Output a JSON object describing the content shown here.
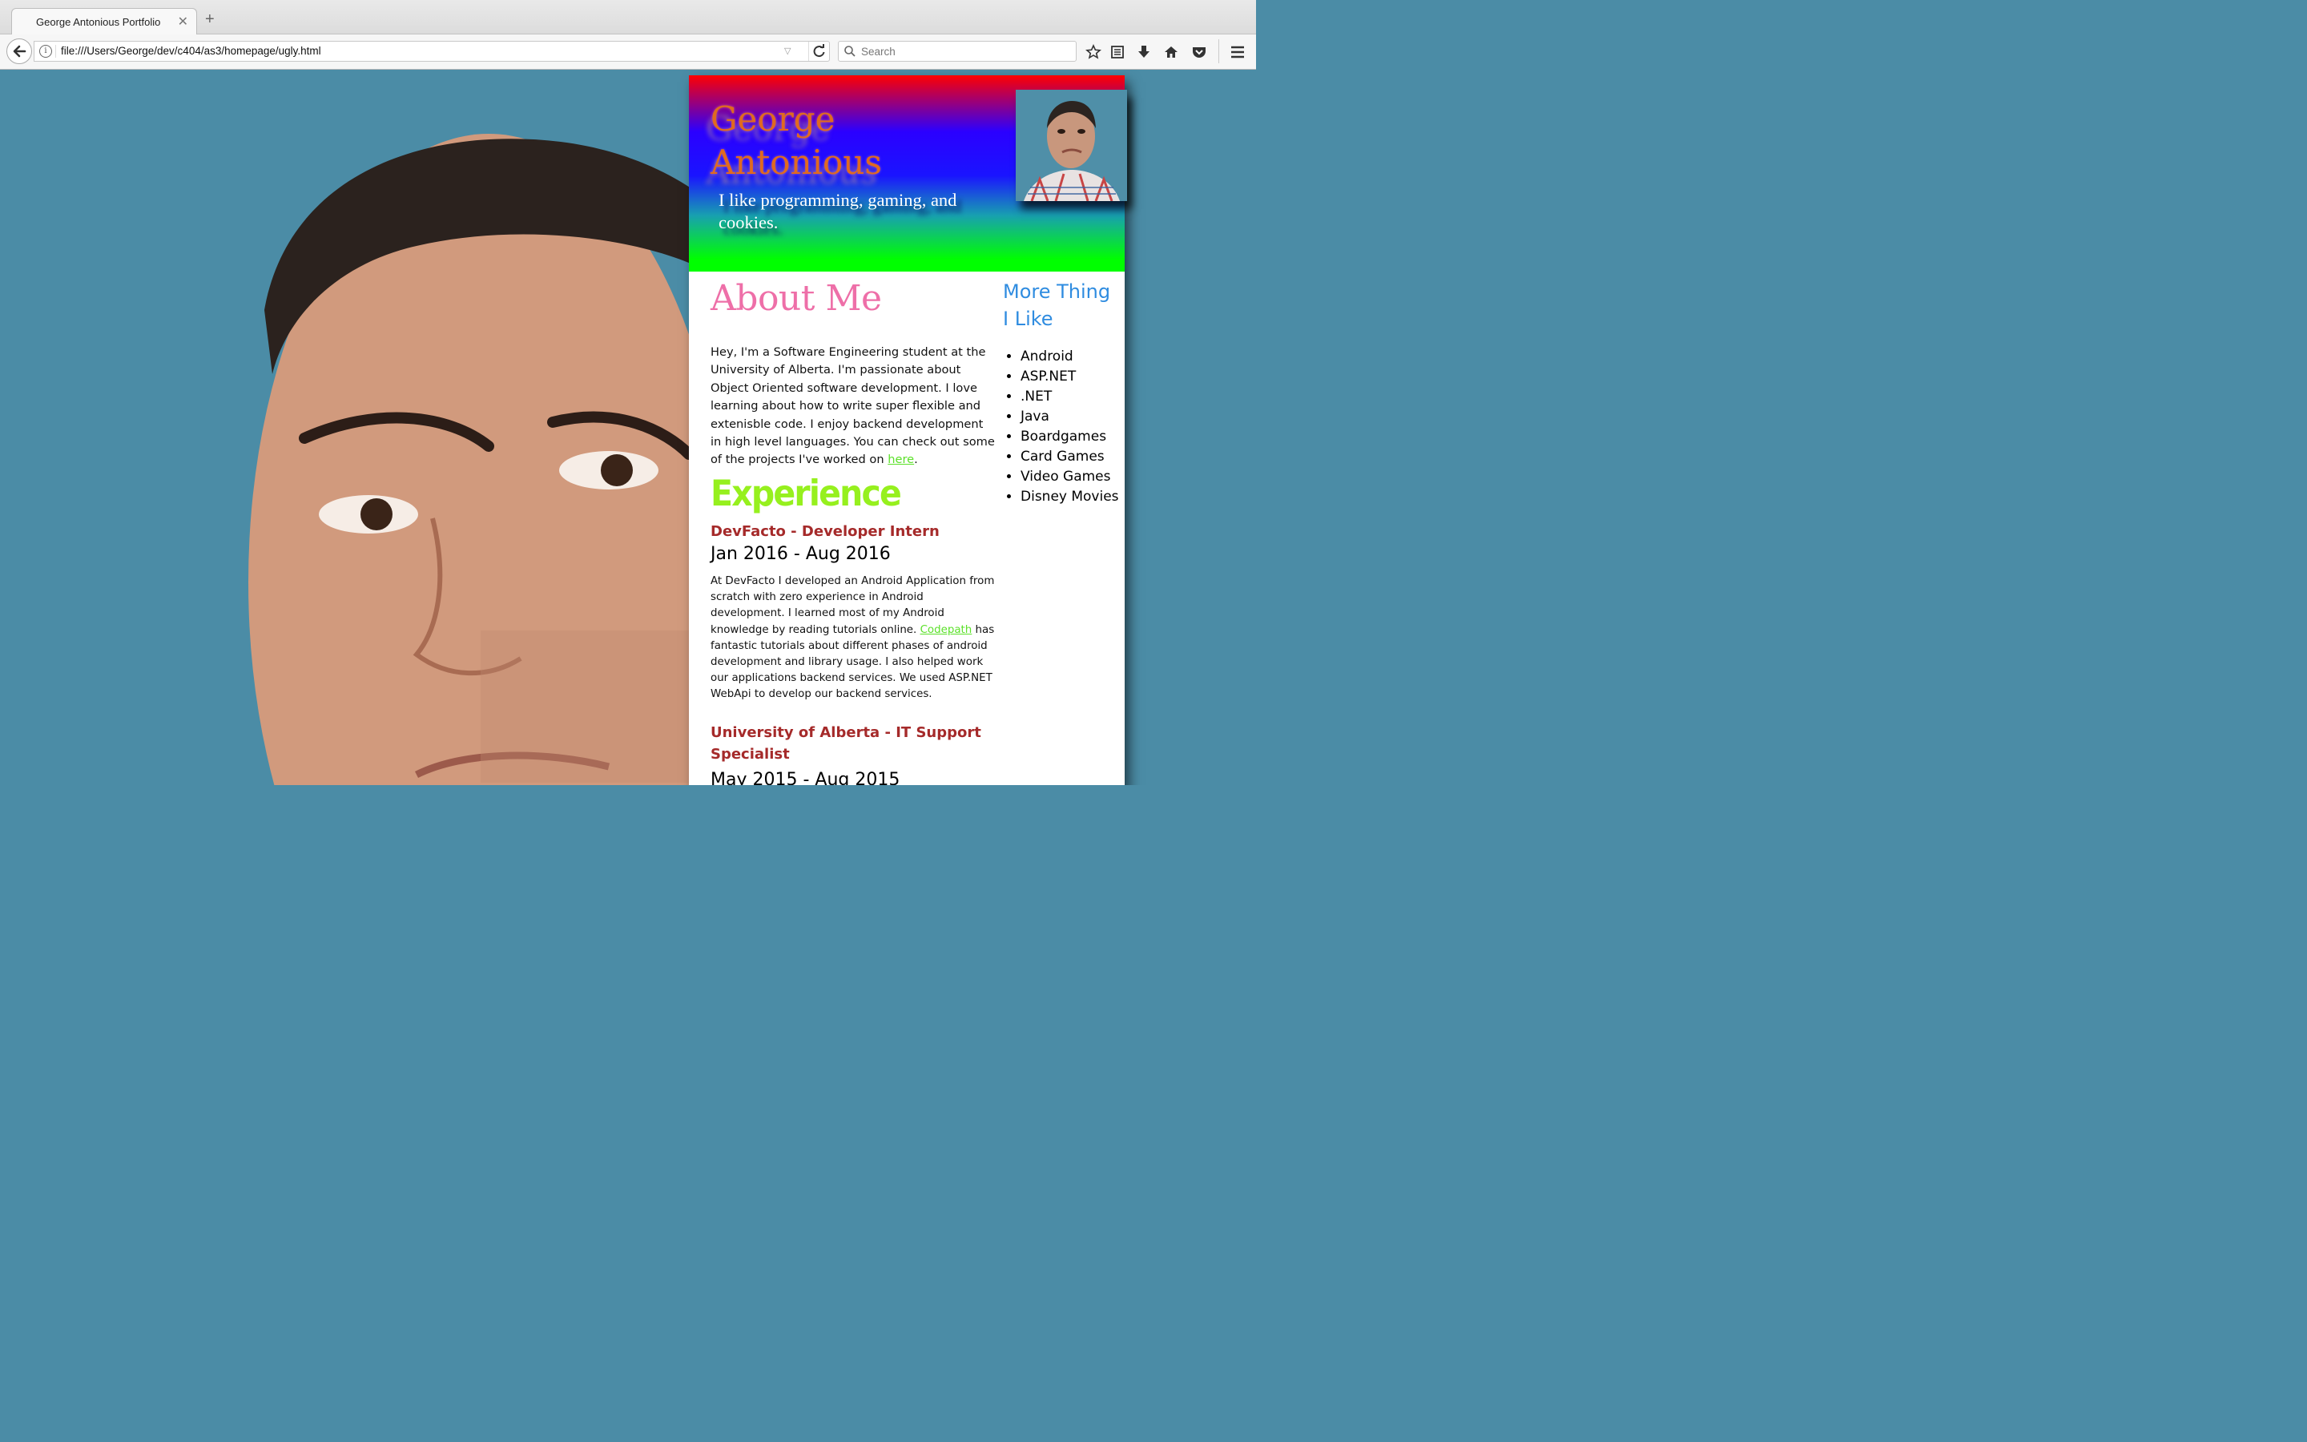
{
  "browser": {
    "tab_title": "George Antonious Portfolio",
    "url": "file:///Users/George/dev/c404/as3/homepage/ugly.html",
    "search_placeholder": "Search"
  },
  "header": {
    "name": "George Antonious",
    "tagline": "I like programming, gaming, and cookies."
  },
  "about": {
    "title": "About Me",
    "text_before_link": "Hey, I'm a Software Engineering student at the University of Alberta. I'm passionate about Object Oriented software development. I love learning about how to write super flexible and extenisble code. I enjoy backend development in high level languages. You can check out some of the projects I've worked on ",
    "link_text": "here",
    "text_after_link": "."
  },
  "experience": {
    "title": "Experience",
    "jobs": [
      {
        "title": "DevFacto - Developer Intern",
        "dates": "Jan 2016 - Aug 2016",
        "text_before_link": "At DevFacto I developed an Android Application from scratch with zero experience in Android development. I learned most of my Android knowledge by reading tutorials online. ",
        "link_text": "Codepath",
        "text_after_link": " has fantastic tutorials about different phases of android development and library usage. I also helped work our applications backend services. We used ASP.NET WebApi to develop our backend services."
      },
      {
        "title": "University of Alberta - IT Support Specialist",
        "dates": "May 2015 - Aug 2015"
      }
    ]
  },
  "sidebar": {
    "title": "More Thing I Like",
    "items": [
      "Android",
      "ASP.NET",
      ".NET",
      "Java",
      "Boardgames",
      "Card Games",
      "Video Games",
      "Disney Movies"
    ]
  },
  "colors": {
    "page_background": "#4b8ca6",
    "name": "#e06a20",
    "about_title": "#ee6fa8",
    "experience_title": "#96f01e",
    "job_title": "#a52a2a",
    "link": "#5ce12a",
    "sidebar_title": "#2f8ce0"
  }
}
